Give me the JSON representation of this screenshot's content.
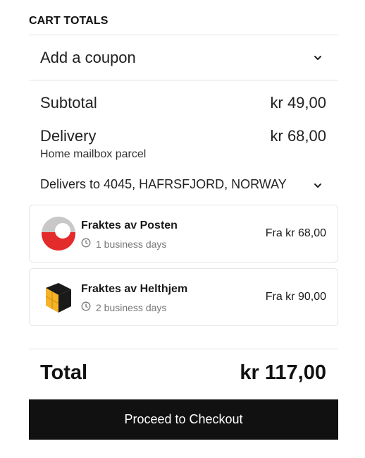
{
  "cart": {
    "heading": "CART TOTALS",
    "coupon": {
      "label": "Add a coupon",
      "icon": "chevron-down-icon"
    },
    "subtotal": {
      "label": "Subtotal",
      "value": "kr 49,00"
    },
    "delivery": {
      "label": "Delivery",
      "value": "kr 68,00",
      "method": "Home mailbox parcel"
    },
    "delivers_to": {
      "prefix": "Delivers to",
      "address": "4045, HAFRSFJORD, NORWAY",
      "icon": "chevron-down-icon"
    },
    "shipping_options": [
      {
        "name": "Fraktes av Posten",
        "days": "1 business days",
        "price": "Fra kr 68,00",
        "logo": "posten-logo",
        "colors": [
          "#c8c8c8",
          "#e32b2b",
          "#ffffff"
        ]
      },
      {
        "name": "Fraktes av Helthjem",
        "days": "2 business days",
        "price": "Fra kr 90,00",
        "logo": "helthjem-logo",
        "colors": [
          "#f5b326",
          "#1a1a1a"
        ]
      }
    ],
    "total": {
      "label": "Total",
      "value": "kr 117,00"
    },
    "checkout_label": "Proceed to Checkout"
  },
  "colors": {
    "button_bg": "#111111",
    "button_text": "#ffffff",
    "divider": "#e3e3e3"
  }
}
